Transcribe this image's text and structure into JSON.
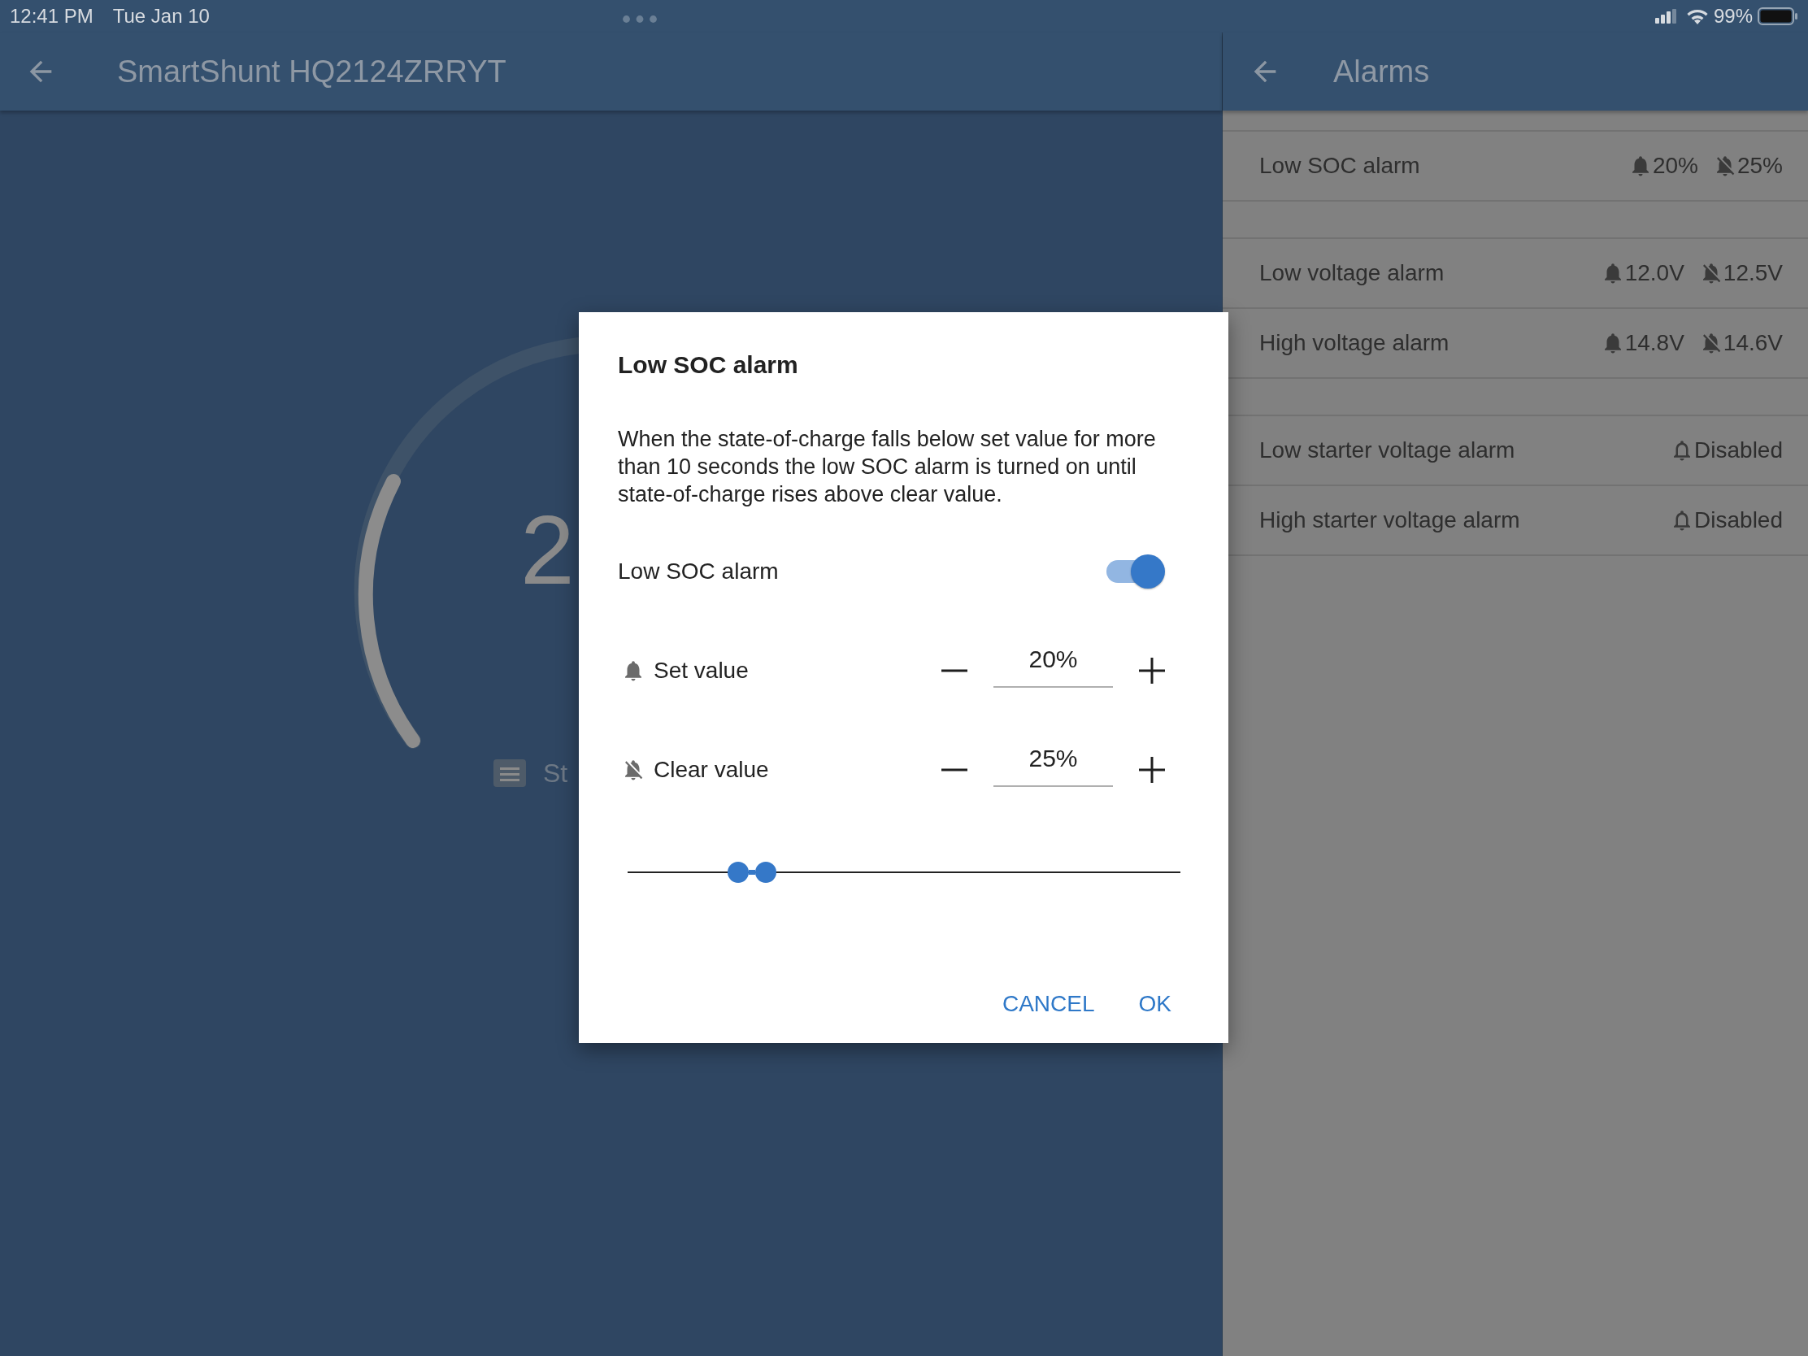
{
  "status_bar": {
    "time": "12:41 PM",
    "date": "Tue Jan 10",
    "battery": "99%"
  },
  "device_panel": {
    "title": "SmartShunt HQ2124ZRRYT",
    "gauge_value": "2",
    "gauge_label": "St"
  },
  "alarms_panel": {
    "title": "Alarms",
    "groups": [
      {
        "items": [
          {
            "name": "Low SOC alarm",
            "kind": "range",
            "set": "20%",
            "clear": "25%"
          }
        ]
      },
      {
        "items": [
          {
            "name": "Low voltage alarm",
            "kind": "range",
            "set": "12.0V",
            "clear": "12.5V"
          },
          {
            "name": "High voltage alarm",
            "kind": "range",
            "set": "14.8V",
            "clear": "14.6V"
          }
        ]
      },
      {
        "items": [
          {
            "name": "Low starter voltage alarm",
            "kind": "disabled",
            "status": "Disabled"
          },
          {
            "name": "High starter voltage alarm",
            "kind": "disabled",
            "status": "Disabled"
          }
        ]
      }
    ]
  },
  "dialog": {
    "title": "Low SOC alarm",
    "description": "When the state-of-charge falls below set value for more than 10 seconds the low SOC alarm is turned on until state-of-charge rises above clear value.",
    "toggle": {
      "label": "Low SOC alarm",
      "on": true
    },
    "fields": [
      {
        "kind": "set",
        "label": "Set value",
        "value": "20%",
        "level": 0.2
      },
      {
        "kind": "clear",
        "label": "Clear value",
        "value": "25%",
        "level": 0.25
      }
    ],
    "buttons": [
      "CANCEL",
      "OK"
    ]
  }
}
